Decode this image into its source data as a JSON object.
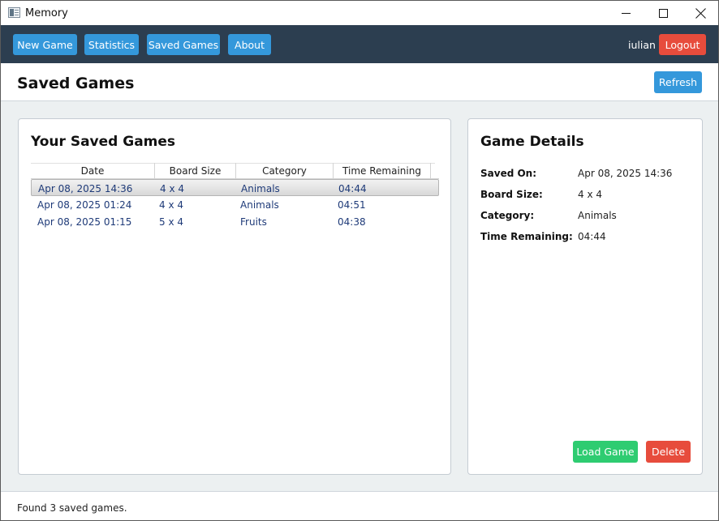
{
  "window": {
    "title": "Memory"
  },
  "nav": {
    "new_game": "New Game",
    "statistics": "Statistics",
    "saved_games": "Saved Games",
    "about": "About",
    "username": "iulian",
    "logout": "Logout"
  },
  "header": {
    "title": "Saved Games",
    "refresh": "Refresh"
  },
  "list_panel": {
    "title": "Your Saved Games",
    "columns": [
      "Date",
      "Board Size",
      "Category",
      "Time Remaining"
    ],
    "rows": [
      {
        "date": "Apr 08, 2025 14:36",
        "board_size": "4 x 4",
        "category": "Animals",
        "time_remaining": "04:44",
        "selected": true
      },
      {
        "date": "Apr 08, 2025 01:24",
        "board_size": "4 x 4",
        "category": "Animals",
        "time_remaining": "04:51",
        "selected": false
      },
      {
        "date": "Apr 08, 2025 01:15",
        "board_size": "5 x 4",
        "category": "Fruits",
        "time_remaining": "04:38",
        "selected": false
      }
    ]
  },
  "details_panel": {
    "title": "Game Details",
    "fields": [
      {
        "label": "Saved On:",
        "value": "Apr 08, 2025 14:36"
      },
      {
        "label": "Board Size:",
        "value": "4 x 4"
      },
      {
        "label": "Category:",
        "value": "Animals"
      },
      {
        "label": "Time Remaining:",
        "value": "04:44"
      }
    ],
    "load_game": "Load Game",
    "delete": "Delete"
  },
  "status": {
    "text": "Found 3 saved games."
  },
  "colors": {
    "navbar_bg": "#2c3e50",
    "primary": "#3498db",
    "danger": "#e74c3c",
    "success": "#2ecc71",
    "content_bg": "#ecf0f1",
    "row_text": "#1e3a78"
  }
}
